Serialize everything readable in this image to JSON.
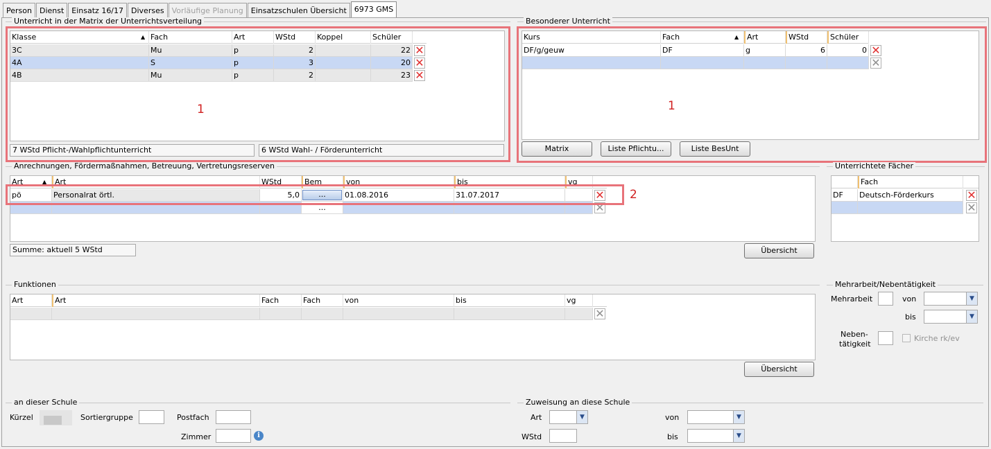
{
  "tabs": [
    "Person",
    "Dienst",
    "Einsatz 16/17",
    "Diverses",
    "Vorläufige Planung",
    "Einsatzschulen Übersicht",
    "6973 GMS"
  ],
  "matrix": {
    "title": "Unterricht in der Matrix der Unterrichtsverteilung",
    "headers": [
      "Klasse",
      "Fach",
      "Art",
      "WStd",
      "Koppel",
      "Schüler"
    ],
    "rows": [
      {
        "klasse": "3C",
        "fach": "Mu",
        "art": "p",
        "wstd": "2",
        "koppel": "",
        "schueler": "22"
      },
      {
        "klasse": "4A",
        "fach": "S",
        "art": "p",
        "wstd": "3",
        "koppel": "",
        "schueler": "20"
      },
      {
        "klasse": "4B",
        "fach": "Mu",
        "art": "p",
        "wstd": "2",
        "koppel": "",
        "schueler": "23"
      }
    ],
    "annotation": "1",
    "info_left": "7 WStd Pflicht-/Wahlpflichtunterricht",
    "info_right": "6 WStd Wahl- / Förderunterricht"
  },
  "besonderer": {
    "title": "Besonderer Unterricht",
    "headers": [
      "Kurs",
      "Fach",
      "Art",
      "WStd",
      "Schüler"
    ],
    "rows": [
      {
        "kurs": "DF/g/geuw",
        "fach": "DF",
        "art": "g",
        "wstd": "6",
        "schueler": "0"
      }
    ],
    "annotation": "1",
    "buttons": [
      "Matrix",
      "Liste Pflichtu...",
      "Liste BesUnt"
    ]
  },
  "anrechnungen": {
    "title": "Anrechnungen, Fördermaßnahmen, Betreuung, Vertretungsreserven",
    "headers": [
      "Art",
      "Art",
      "WStd",
      "Bem",
      "von",
      "bis",
      "vg"
    ],
    "rows": [
      {
        "art": "pö",
        "art2": "Personalrat örtl.",
        "wstd": "5,0",
        "bem": "...",
        "von": "01.08.2016",
        "bis": "31.07.2017",
        "vg": ""
      }
    ],
    "empty_bem": "...",
    "annotation": "2",
    "summe": "Summe: aktuell 5 WStd",
    "button": "Übersicht"
  },
  "faecher": {
    "title": "Unterrichtete Fächer",
    "header": "Fach",
    "rows": [
      {
        "code": "DF",
        "name": "Deutsch-Förderkurs"
      }
    ]
  },
  "funktionen": {
    "title": "Funktionen",
    "headers": [
      "Art",
      "Art",
      "Fach",
      "Fach",
      "von",
      "bis",
      "vg"
    ],
    "button": "Übersicht"
  },
  "mehrarbeit": {
    "title": "Mehrarbeit/Nebentätigkeit",
    "mehrarbeit_label": "Mehrarbeit",
    "von_label": "von",
    "bis_label": "bis",
    "neben_label_1": "Neben-",
    "neben_label_2": "tätigkeit",
    "kirche_label": "Kirche rk/ev"
  },
  "schule": {
    "title": "an dieser Schule",
    "kuerzel": "Kürzel",
    "sortiergruppe": "Sortiergruppe",
    "postfach": "Postfach",
    "zimmer": "Zimmer"
  },
  "zuweisung": {
    "title": "Zuweisung an diese Schule",
    "art": "Art",
    "wstd": "WStd",
    "von": "von",
    "bis": "bis"
  },
  "colors": {
    "selected_row": "#c8d8f4",
    "highlight": "#e8737a",
    "annotation": "#d02020"
  }
}
